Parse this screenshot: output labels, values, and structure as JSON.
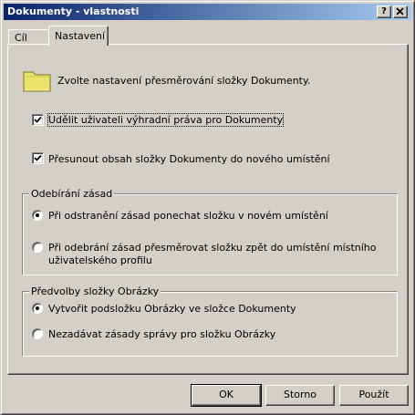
{
  "window": {
    "title": "Dokumenty - vlastnosti",
    "help_button": "?",
    "close_button": "✕"
  },
  "tabs": [
    {
      "label": "Cíl",
      "active": false
    },
    {
      "label": "Nastavení",
      "active": true
    }
  ],
  "main": {
    "intro": "Zvolte nastavení přesměrování složky Dokumenty.",
    "checkbox_exclusive": {
      "label": "Udělit uživateli výhradní práva pro Dokumenty",
      "checked": true
    },
    "checkbox_move": {
      "label": "Přesunout obsah složky Dokumenty do nového umístění",
      "checked": true
    }
  },
  "policy_removal": {
    "title": "Odebírání zásad",
    "option_keep": {
      "label": "Při odstranění zásad ponechat složku v novém umístění",
      "selected": true
    },
    "option_redirect": {
      "label_line1": "Při odebrání zásad přesměrovat složku zpět do umístění místního",
      "label_line2": "uživatelského profilu",
      "selected": false
    }
  },
  "pictures_prefs": {
    "title": "Předvolby složky Obrázky",
    "option_create": {
      "label": "Vytvořit podsložku Obrázky ve složce Dokumenty",
      "selected": true
    },
    "option_none": {
      "label": "Nezadávat zásady správy pro složku Obrázky",
      "selected": false
    }
  },
  "buttons": {
    "ok": "OK",
    "cancel": "Storno",
    "apply": "Použít"
  },
  "colors": {
    "face": "#d4d0c8",
    "title_start": "#0a246a",
    "title_end": "#a6caf0",
    "folder_fill": "#e9e36a"
  }
}
